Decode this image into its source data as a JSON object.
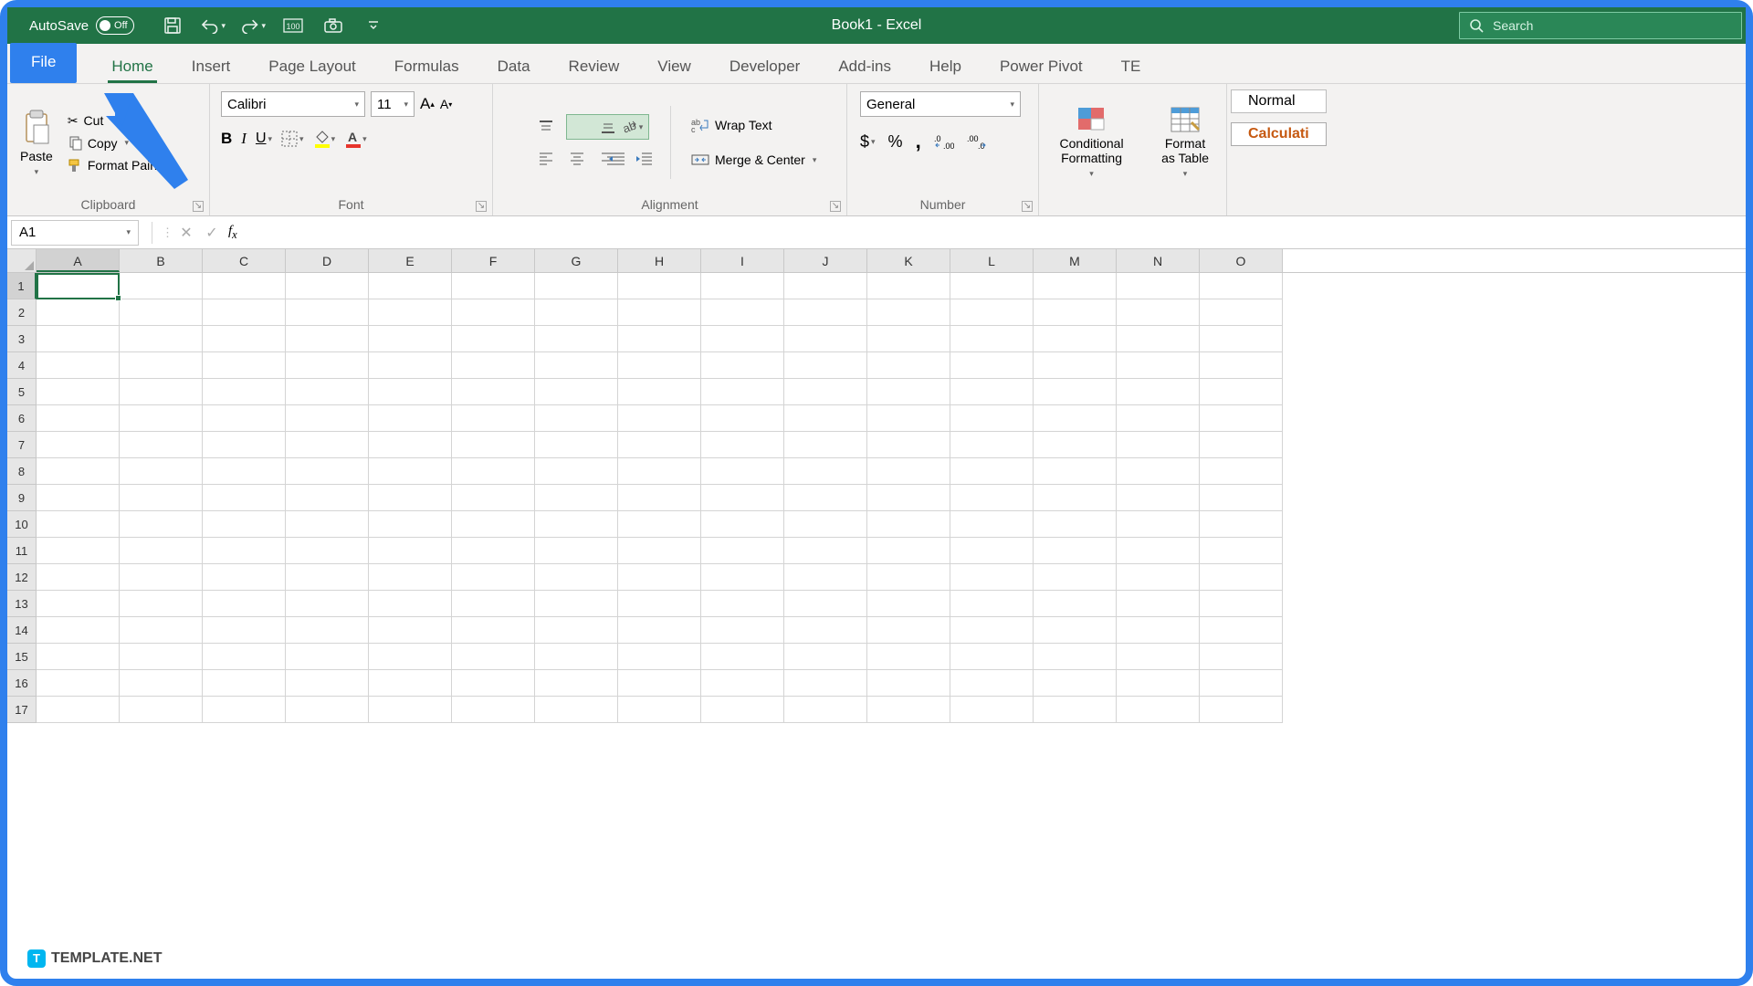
{
  "titlebar": {
    "autosave_label": "AutoSave",
    "autosave_state": "Off",
    "title": "Book1  -  Excel",
    "search_placeholder": "Search"
  },
  "tabs": [
    "File",
    "Home",
    "Insert",
    "Page Layout",
    "Formulas",
    "Data",
    "Review",
    "View",
    "Developer",
    "Add-ins",
    "Help",
    "Power Pivot",
    "TE"
  ],
  "active_tab": "Home",
  "highlight_tab": "File",
  "ribbon": {
    "clipboard": {
      "paste": "Paste",
      "cut": "Cut",
      "copy": "Copy",
      "format_painter": "Format Painter",
      "label": "Clipboard"
    },
    "font": {
      "name": "Calibri",
      "size": "11",
      "label": "Font"
    },
    "alignment": {
      "wrap": "Wrap Text",
      "merge": "Merge & Center",
      "label": "Alignment"
    },
    "number": {
      "format": "General",
      "label": "Number"
    },
    "styles": {
      "conditional": "Conditional Formatting",
      "table": "Format as Table",
      "normal": "Normal",
      "calc": "Calculati"
    }
  },
  "namebox": "A1",
  "formula": "",
  "columns": [
    "A",
    "B",
    "C",
    "D",
    "E",
    "F",
    "G",
    "H",
    "I",
    "J",
    "K",
    "L",
    "M",
    "N",
    "O"
  ],
  "rowcount": 17,
  "selected_cell": "A1",
  "watermark": "TEMPLATE.NET"
}
